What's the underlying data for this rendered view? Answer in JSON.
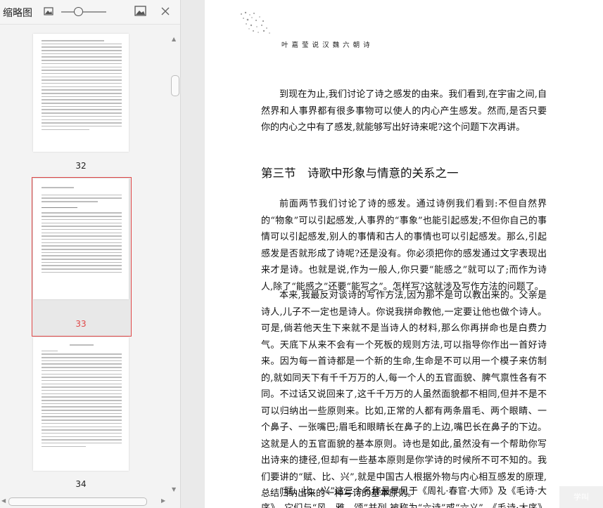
{
  "sidebar": {
    "title": "缩略图",
    "thumbnails": [
      {
        "page_label": "32",
        "selected": false
      },
      {
        "page_label": "33",
        "selected": true
      },
      {
        "page_label": "34",
        "selected": false
      }
    ]
  },
  "toolbar_icons": [
    "image-small-icon",
    "zoom-slider",
    "image-large-icon",
    "close-icon"
  ],
  "colors": {
    "selected_frame": "#e04848",
    "selected_label": "#e04848",
    "panel_bg": "#f3f3f3"
  },
  "document": {
    "running_head": "叶 嘉 莹 说 汉 魏 六 朝 诗",
    "paragraphs": [
      "到现在为止,我们讨论了诗之感发的由来。我们看到,在宇宙之间,自然界和人事界都有很多事物可以使人的内心产生感发。然而,是否只要你的内心之中有了感发,就能够写出好诗来呢?这个问题下次再讲。",
      "前面两节我们讨论了诗的感发。通过诗例我们看到:不但自然界的“物象”可以引起感发,人事界的“事象”也能引起感发;不但你自己的事情可以引起感发,别人的事情和古人的事情也可以引起感发。那么,引起感发是否就形成了诗呢?还是没有。你必须把你的感发通过文字表现出来才是诗。也就是说,作为一般人,你只要“能感之”就可以了;而作为诗人,除了“能感之”还要“能写之”。怎样写?这就涉及写作方法的问题了。",
      "本来,我最反对谈诗的写作方法,因为那不是可以教出来的。父亲是诗人,儿子不一定也是诗人。你说我拼命教他,一定要让他也做个诗人。可是,倘若他天生下来就不是当诗人的材料,那么你再拼命也是白费力气。天底下从来不会有一个死板的规则方法,可以指导你作出一首好诗来。因为每一首诗都是一个新的生命,生命是不可以用一个模子来仿制的,就如同天下有千千万万的人,每一个人的五官面貌、脾气禀性各有不同。不过话又说回来了,这千千万万的人虽然面貌都不相同,但并不是不可以归纳出一些原则来。比如,正常的人都有两条眉毛、两个眼睛、一个鼻子、一张嘴巴;眉毛和眼睛长在鼻子的上边,嘴巴长在鼻子的下边。这就是人的五官面貌的基本原则。诗也是如此,虽然没有一个帮助你写出诗来的捷径,但却有一些基本原则是你学诗的时候所不可不知的。我们要讲的“赋、比、兴”,就是中国古人根据外物与内心相互感发的原理,总结归纳出来的一种写诗的基本原则。",
      "“赋、比、兴”这三个名称最早见于《周礼·春官·大师》及《毛诗·大序》。它们与“风、雅、颂”并列,被称为“六诗”或“六义”。《毛诗·大序》是"
    ],
    "heading": "第三节　诗歌中形象与情意的关系之一"
  },
  "overlay_badge": "学叫"
}
